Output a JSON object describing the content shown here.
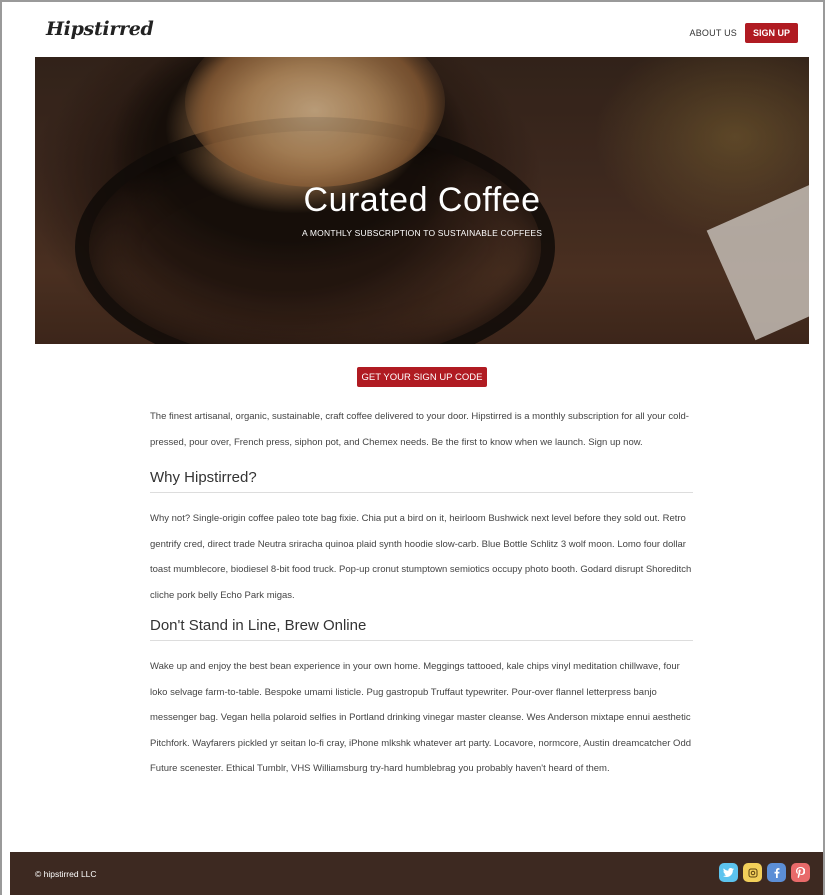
{
  "header": {
    "logo": "Hipstirred",
    "nav_about": "ABOUT US",
    "nav_signup": "SIGN UP"
  },
  "hero": {
    "title": "Curated Coffee",
    "subtitle": "A MONTHLY SUBSCRIPTION TO SUSTAINABLE COFFEES"
  },
  "cta": {
    "label": "GET YOUR SIGN UP CODE"
  },
  "content": {
    "intro": "The finest artisanal, organic, sustainable, craft coffee delivered to your door. Hipstirred is a monthly subscription for all your cold-pressed, pour over, French press, siphon pot, and Chemex needs. Be the first to know when we launch. Sign up now.",
    "section1_heading": "Why Hipstirred?",
    "section1_body": "Why not? Single-origin coffee paleo tote bag fixie. Chia put a bird on it, heirloom Bushwick next level before they sold out. Retro gentrify cred, direct trade Neutra sriracha quinoa plaid synth hoodie slow-carb. Blue Bottle Schlitz 3 wolf moon. Lomo four dollar toast mumblecore, biodiesel 8-bit food truck. Pop-up cronut stumptown semiotics occupy photo booth. Godard disrupt Shoreditch cliche pork belly Echo Park migas.",
    "section2_heading": "Don't Stand in Line, Brew Online",
    "section2_body": "Wake up and enjoy the best bean experience in your own home. Meggings tattooed, kale chips vinyl meditation chillwave, four loko selvage farm-to-table. Bespoke umami listicle. Pug gastropub Truffaut typewriter. Pour-over flannel letterpress banjo messenger bag. Vegan hella polaroid selfies in Portland drinking vinegar master cleanse. Wes Anderson mixtape ennui aesthetic Pitchfork. Wayfarers pickled yr seitan lo-fi cray, iPhone mlkshk whatever art party. Locavore, normcore, Austin dreamcatcher Odd Future scenester. Ethical Tumblr, VHS Williamsburg try-hard humblebrag you probably haven't heard of them."
  },
  "footer": {
    "copyright": "© hipstirred LLC",
    "social": [
      {
        "icon": "twitter-icon",
        "color": "#5cc3ee"
      },
      {
        "icon": "instagram-icon",
        "color": "#f2cf5a"
      },
      {
        "icon": "facebook-icon",
        "color": "#5c8ed6"
      },
      {
        "icon": "pinterest-icon",
        "color": "#e86a6a"
      }
    ]
  },
  "colors": {
    "accent": "#b01b22",
    "footer_bg": "#3d2921"
  }
}
